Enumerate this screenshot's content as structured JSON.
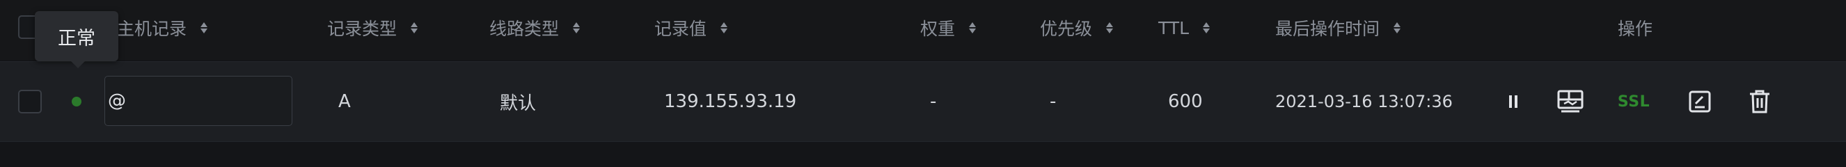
{
  "header": {
    "host_record": "主机记录",
    "record_type": "记录类型",
    "line_type": "线路类型",
    "record_value": "记录值",
    "weight": "权重",
    "priority": "优先级",
    "ttl": "TTL",
    "last_op_time": "最后操作时间",
    "actions": "操作"
  },
  "tooltip": {
    "status_text": "正常"
  },
  "row": {
    "host": "@",
    "type": "A",
    "line": "默认",
    "value": "139.155.93.19",
    "weight": "-",
    "priority": "-",
    "ttl": "600",
    "time": "2021-03-16 13:07:36",
    "ssl_label": "SSL"
  },
  "colors": {
    "status_ok": "#2b7a2b",
    "ssl_green": "#2f8a2f",
    "row_bg": "#1d1f23",
    "header_bg": "#161719"
  },
  "icons": {
    "pause": "pause-icon",
    "dashboard": "dashboard-icon",
    "edit": "edit-icon",
    "delete": "trash-icon"
  }
}
